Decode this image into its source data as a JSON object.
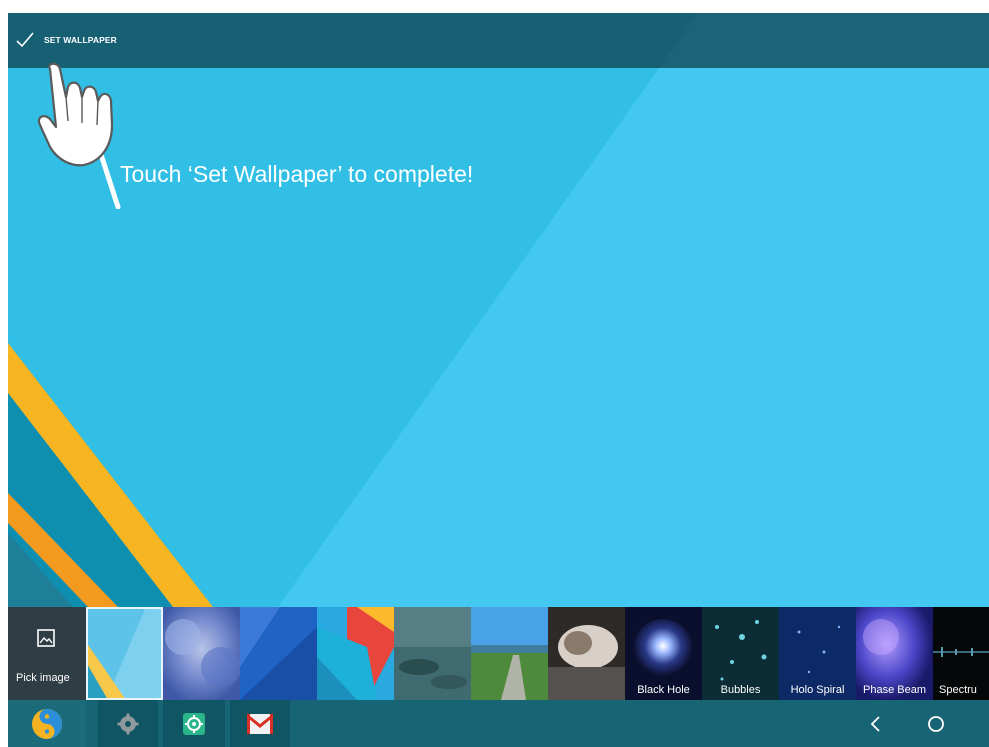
{
  "action_bar": {
    "set_wallpaper_label": "SET WALLPAPER",
    "check_icon": "checkmark-icon"
  },
  "tutorial": {
    "hint": "Touch ‘Set Wallpaper’ to complete!",
    "hand_icon": "pointing-hand-icon"
  },
  "wallpapers": {
    "pick_image_label": "Pick image",
    "items": [
      {
        "label": "",
        "selected": true
      },
      {
        "label": ""
      },
      {
        "label": ""
      },
      {
        "label": ""
      },
      {
        "label": ""
      },
      {
        "label": ""
      },
      {
        "label": ""
      },
      {
        "label": "Black Hole"
      },
      {
        "label": "Bubbles"
      },
      {
        "label": "Holo Spiral"
      },
      {
        "label": "Phase Beam"
      },
      {
        "label": "Spectru"
      }
    ]
  },
  "navbar": {
    "apps": [
      "launcher-app-icon",
      "settings-gear-app-icon",
      "settings-app-icon",
      "gmail-icon"
    ],
    "back_icon": "back-chevron-icon",
    "home_icon": "home-circle-icon"
  },
  "colors": {
    "wallpaper_blue": "#43c8f2",
    "action_bar": "#0e3c48",
    "navbar": "#176474",
    "accent_yellow": "#f7b522"
  }
}
